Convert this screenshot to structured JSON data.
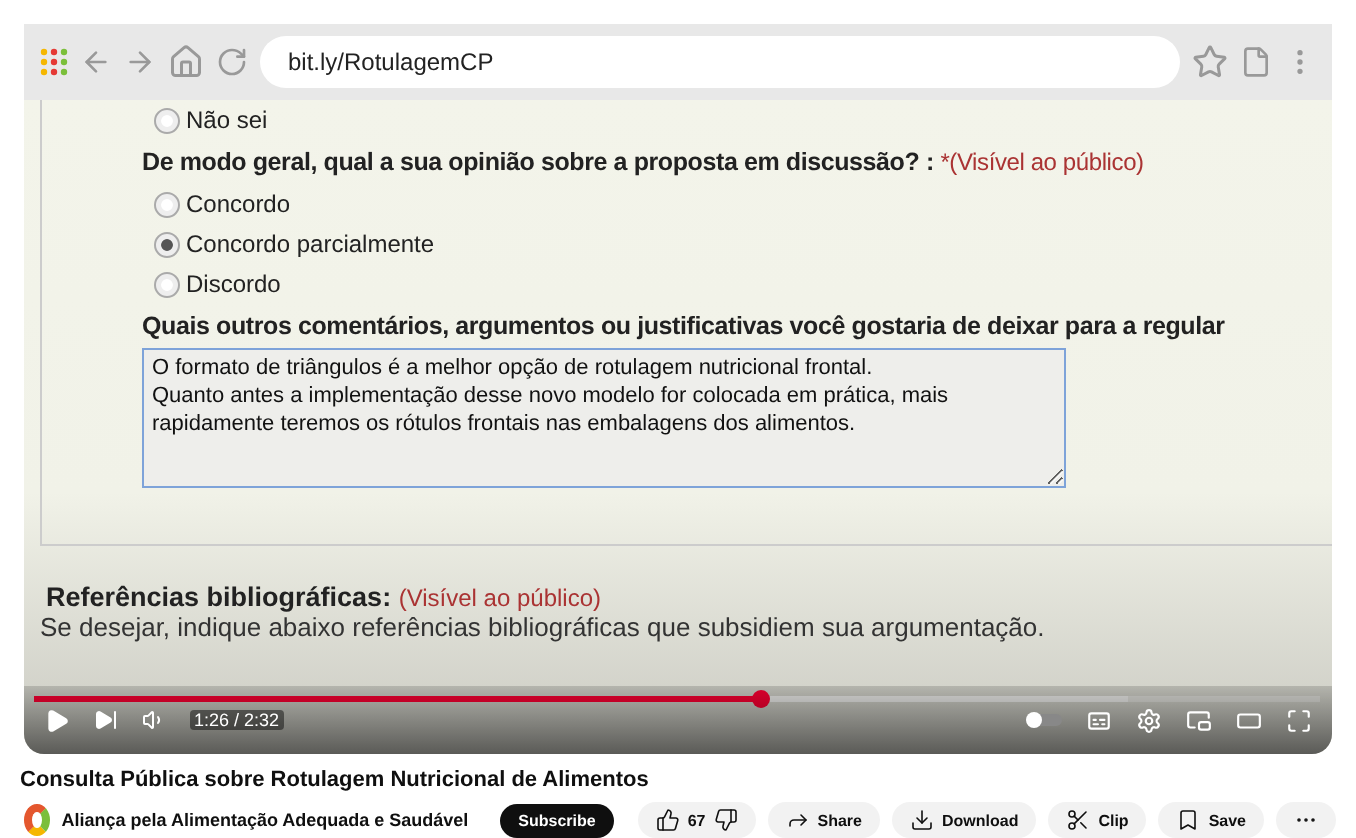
{
  "browser": {
    "url": "bit.ly/RotulagemCP"
  },
  "form": {
    "prev_option": {
      "label": "Não sei",
      "selected": false
    },
    "question": {
      "text": "De modo geral, qual a sua opinião sobre a proposta em discussão? :",
      "note": "*(Visível ao público)"
    },
    "options": [
      {
        "label": "Concordo",
        "selected": false
      },
      {
        "label": "Concordo parcialmente",
        "selected": true
      },
      {
        "label": "Discordo",
        "selected": false
      }
    ],
    "comment_question": "Quais outros comentários, argumentos ou justificativas você gostaria de deixar para a regular",
    "comment_value": "O formato de triângulos é a melhor opção de rotulagem nutricional frontal.\nQuanto antes a implementação desse novo modelo for colocada em prática, mais\nrapidamente teremos os rótulos frontais nas embalagens dos alimentos.",
    "references": {
      "title": "Referências bibliográficas:",
      "note": "(Visível ao público)",
      "hint": "Se desejar, indique abaixo referências bibliográficas que subsidiem sua argumentação."
    }
  },
  "player": {
    "progress": {
      "level": 0.565
    },
    "time": "1:26 / 2:32"
  },
  "video_title": "Consulta Pública sobre Rotulagem Nutricional de Alimentos",
  "channel": {
    "name": "Aliança pela Alimentação Adequada e Saudável",
    "subscribe": "Subscribe"
  },
  "actions": {
    "likes": "67",
    "share": "Share",
    "download": "Download",
    "clip": "Clip",
    "save": "Save"
  }
}
